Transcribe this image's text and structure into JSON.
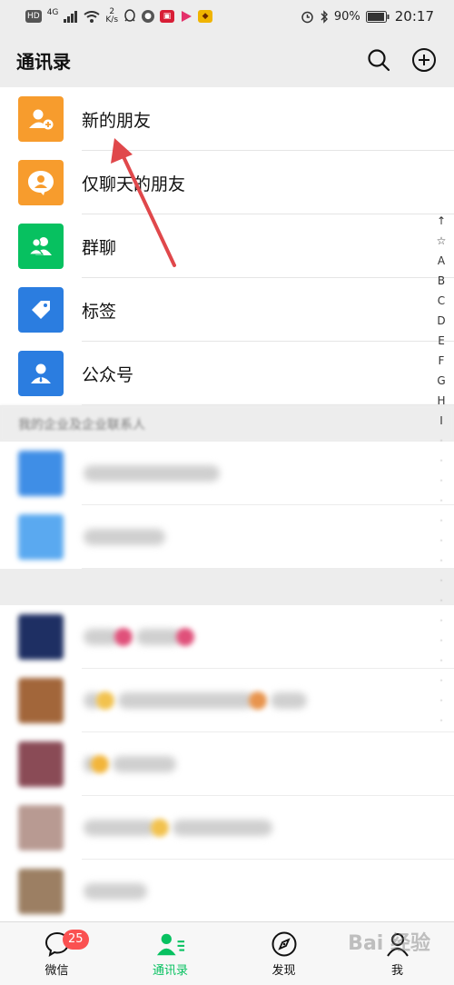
{
  "status_bar": {
    "network_left": "HD",
    "network_type": "4G",
    "speed_value": "2",
    "speed_unit": "K/s",
    "battery": "90%",
    "time": "20:17"
  },
  "header": {
    "title": "通讯录"
  },
  "function_items": [
    {
      "label": "新的朋友",
      "color": "#f79c2d",
      "icon": "new-friend-icon"
    },
    {
      "label": "仅聊天的朋友",
      "color": "#f79c2d",
      "icon": "chat-only-icon"
    },
    {
      "label": "群聊",
      "color": "#07c160",
      "icon": "group-chat-icon"
    },
    {
      "label": "标签",
      "color": "#2b7de0",
      "icon": "tag-icon"
    },
    {
      "label": "公众号",
      "color": "#2b7de0",
      "icon": "official-account-icon"
    }
  ],
  "sections": {
    "enterprise_header": "我的企业及企业联系人"
  },
  "alphabet_index": [
    "↑",
    "☆",
    "A",
    "B",
    "C",
    "D",
    "E",
    "F",
    "G",
    "H",
    "I"
  ],
  "tabs": [
    {
      "label": "微信",
      "badge": "25"
    },
    {
      "label": "通讯录"
    },
    {
      "label": "发现"
    },
    {
      "label": "我"
    }
  ],
  "watermark": "Bai 经验",
  "colors": {
    "accent": "#07c160",
    "badge": "#fa5151",
    "arrow": "#e0484b"
  }
}
